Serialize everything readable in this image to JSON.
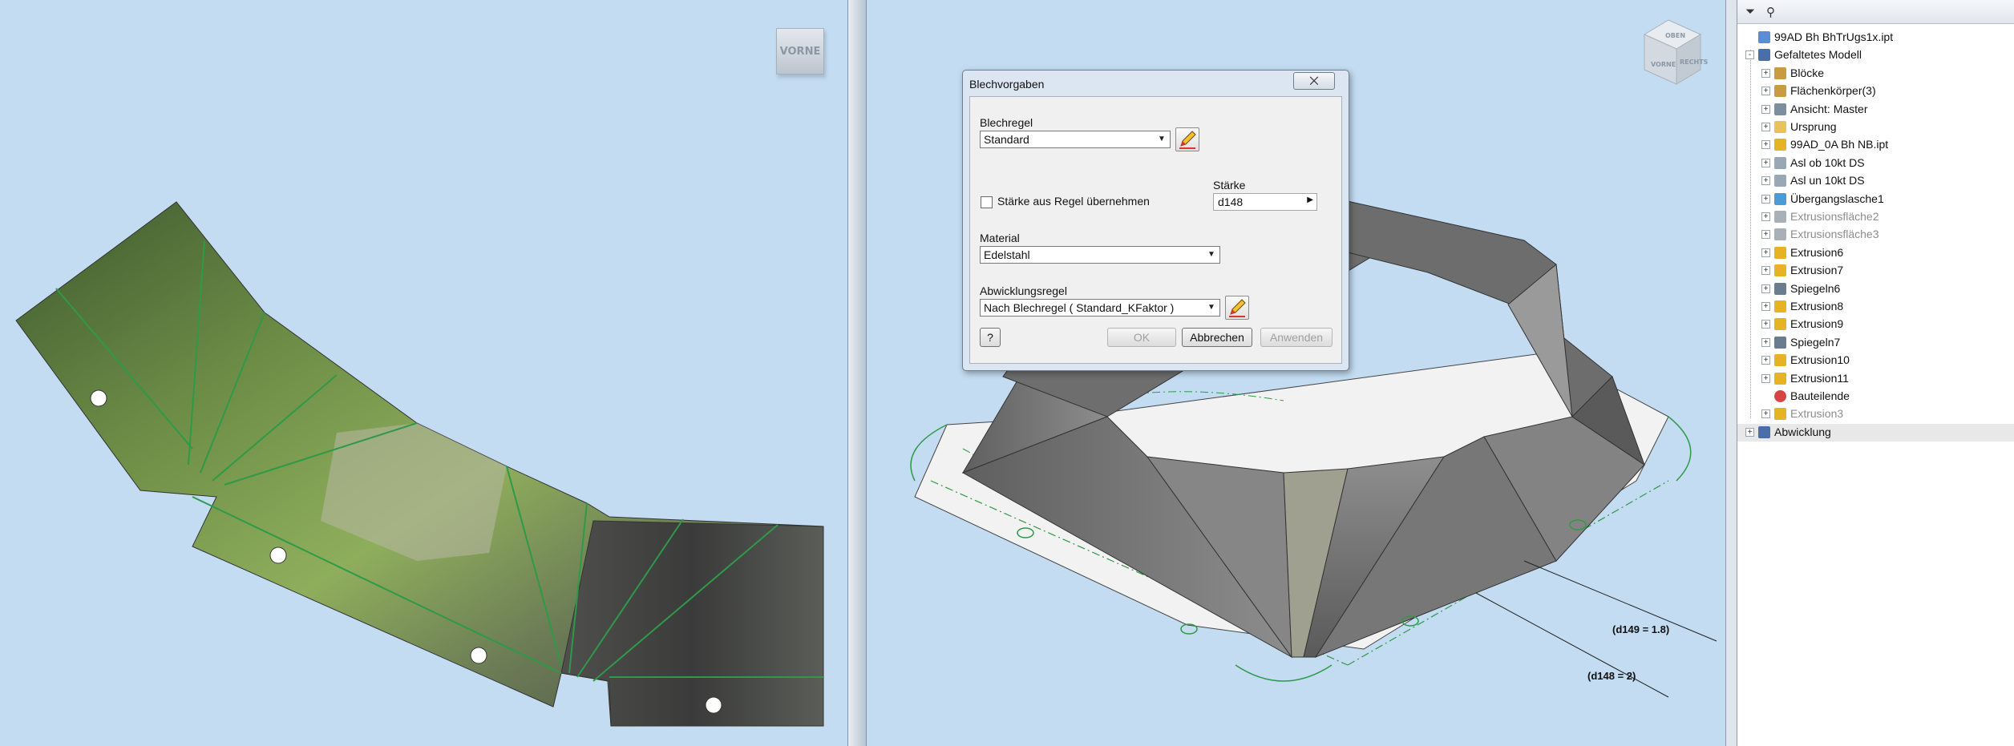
{
  "viewport_left": {
    "viewcube_label": "VORNE"
  },
  "viewport_right": {
    "viewcube_top": "OBEN",
    "viewcube_front": "VORNE",
    "viewcube_right": "RECHTS",
    "annotation_1": "(d149 = 1.8)",
    "annotation_2": "(d148 = 2)"
  },
  "dialog": {
    "title": "Blechvorgaben",
    "close": "⨉",
    "blechregel_label": "Blechregel",
    "blechregel_value": "Standard",
    "staerke_label": "Stärke",
    "staerke_value": "d148",
    "checkbox_label": "Stärke aus Regel übernehmen",
    "material_label": "Material",
    "material_value": "Edelstahl",
    "abwicklungsregel_label": "Abwicklungsregel",
    "abwicklungsregel_value": "Nach Blechregel ( Standard_KFaktor )",
    "help": "?",
    "ok": "OK",
    "cancel": "Abbrechen",
    "apply": "Anwenden"
  },
  "browser": {
    "items": [
      {
        "label": "99AD Bh BhTrUgs1x.ipt",
        "icon": "part-icon",
        "level": 0,
        "dim": false,
        "expander": ""
      },
      {
        "label": "Gefaltetes Modell",
        "icon": "folded-model-icon",
        "level": 0,
        "dim": false,
        "expander": "-"
      },
      {
        "label": "Blöcke",
        "icon": "blocks-icon",
        "level": 1,
        "dim": false,
        "expander": "+"
      },
      {
        "label": "Flächenkörper(3)",
        "icon": "surface-bodies-icon",
        "level": 1,
        "dim": false,
        "expander": "+"
      },
      {
        "label": "Ansicht: Master",
        "icon": "view-icon",
        "level": 1,
        "dim": false,
        "expander": "+"
      },
      {
        "label": "Ursprung",
        "icon": "folder-icon",
        "level": 1,
        "dim": false,
        "expander": "+"
      },
      {
        "label": "99AD_0A Bh NB.ipt",
        "icon": "derived-part-icon",
        "level": 1,
        "dim": false,
        "expander": "+"
      },
      {
        "label": "Asl ob 10kt DS",
        "icon": "sketch-icon",
        "level": 1,
        "dim": false,
        "expander": "+"
      },
      {
        "label": "Asl un 10kt DS",
        "icon": "sketch-icon",
        "level": 1,
        "dim": false,
        "expander": "+"
      },
      {
        "label": "Übergangslasche1",
        "icon": "lofted-flange-icon",
        "level": 1,
        "dim": false,
        "expander": "+"
      },
      {
        "label": "Extrusionsfläche2",
        "icon": "extrude-surface-icon",
        "level": 1,
        "dim": true,
        "expander": "+"
      },
      {
        "label": "Extrusionsfläche3",
        "icon": "extrude-surface-icon",
        "level": 1,
        "dim": true,
        "expander": "+"
      },
      {
        "label": "Extrusion6",
        "icon": "extrusion-icon",
        "level": 1,
        "dim": false,
        "expander": "+"
      },
      {
        "label": "Extrusion7",
        "icon": "extrusion-icon",
        "level": 1,
        "dim": false,
        "expander": "+"
      },
      {
        "label": "Spiegeln6",
        "icon": "mirror-icon",
        "level": 1,
        "dim": false,
        "expander": "+"
      },
      {
        "label": "Extrusion8",
        "icon": "extrusion-icon",
        "level": 1,
        "dim": false,
        "expander": "+"
      },
      {
        "label": "Extrusion9",
        "icon": "extrusion-icon",
        "level": 1,
        "dim": false,
        "expander": "+"
      },
      {
        "label": "Spiegeln7",
        "icon": "mirror-icon",
        "level": 1,
        "dim": false,
        "expander": "+"
      },
      {
        "label": "Extrusion10",
        "icon": "extrusion-icon",
        "level": 1,
        "dim": false,
        "expander": "+"
      },
      {
        "label": "Extrusion11",
        "icon": "extrusion-icon",
        "level": 1,
        "dim": false,
        "expander": "+"
      },
      {
        "label": "Bauteilende",
        "icon": "end-of-part-icon",
        "level": 1,
        "dim": false,
        "expander": ""
      },
      {
        "label": "Extrusion3",
        "icon": "extrusion-icon",
        "level": 1,
        "dim": true,
        "expander": "+"
      },
      {
        "label": "Abwicklung",
        "icon": "flat-pattern-icon",
        "level": 0,
        "dim": false,
        "expander": "+"
      }
    ]
  },
  "colors": {
    "viewport_bg": "#c3dcf2",
    "bend_line": "#2e9a48",
    "sheet_metal": "#7a7a7a"
  }
}
